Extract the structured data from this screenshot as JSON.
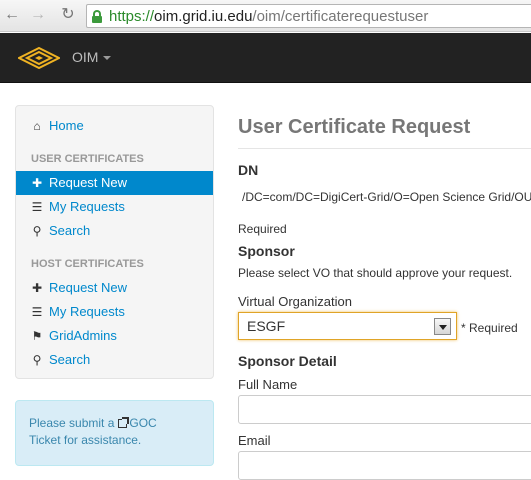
{
  "browser": {
    "scheme": "https://",
    "host": "oim.grid.iu.edu",
    "path": "/oim/certificaterequestuser",
    "back_glyph": "←",
    "forward_glyph": "→",
    "reload_glyph": "↻"
  },
  "navbar": {
    "brand": "OIM"
  },
  "sidebar": {
    "home": "Home",
    "user_header": "USER CERTIFICATES",
    "user_items": [
      {
        "label": "Request New",
        "icon": "plus-icon"
      },
      {
        "label": "My Requests",
        "icon": "list-icon"
      },
      {
        "label": "Search",
        "icon": "search-icon"
      }
    ],
    "host_header": "HOST CERTIFICATES",
    "host_items": [
      {
        "label": "Request New",
        "icon": "plus-icon"
      },
      {
        "label": "My Requests",
        "icon": "list-icon"
      },
      {
        "label": "GridAdmins",
        "icon": "flag-icon"
      },
      {
        "label": "Search",
        "icon": "search-icon"
      }
    ],
    "active_item": "Request New"
  },
  "info": {
    "prefix": "Please submit a",
    "link": "GOC",
    "suffix": "Ticket for assistance."
  },
  "main": {
    "title": "User Certificate Request",
    "dn_label": "DN",
    "dn_value": "/DC=com/DC=DigiCert-Grid/O=Open Science Grid/OU",
    "required": "Required",
    "sponsor_label": "Sponsor",
    "sponsor_help": "Please select VO that should approve your request.",
    "vo_label": "Virtual Organization",
    "vo_value": "ESGF",
    "vo_required": "* Required",
    "sponsor_detail_label": "Sponsor Detail",
    "full_name_label": "Full Name",
    "full_name_value": "",
    "email_label": "Email",
    "email_value": ""
  },
  "colors": {
    "navbar": "#222222",
    "accent": "#0088cc",
    "info_bg": "#d9edf7",
    "url_scheme": "#2a8a2a"
  }
}
